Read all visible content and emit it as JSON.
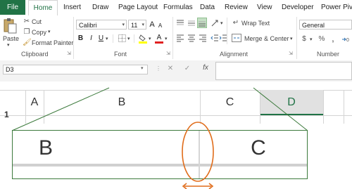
{
  "tabs": [
    "File",
    "Home",
    "Insert",
    "Draw",
    "Page Layout",
    "Formulas",
    "Data",
    "Review",
    "View",
    "Developer",
    "Power Pivot"
  ],
  "clipboard": {
    "paste": "Paste",
    "cut": "Cut",
    "copy": "Copy",
    "format_painter": "Format Painter",
    "group": "Clipboard"
  },
  "font": {
    "name": "Calibri",
    "size": "11",
    "bold": "B",
    "italic": "I",
    "underline": "U",
    "grow": "A",
    "shrink": "A",
    "color_letter": "A",
    "group": "Font"
  },
  "alignment": {
    "wrap_text": "Wrap Text",
    "merge_center": "Merge & Center",
    "group": "Alignment"
  },
  "number": {
    "format": "General",
    "currency": "$",
    "percent": "%",
    "comma": ",",
    "group": "Number"
  },
  "formula_bar": {
    "name_box": "D3",
    "cancel": "✕",
    "enter": "✓",
    "fx": "fx"
  },
  "grid": {
    "columns": [
      "A",
      "B",
      "C",
      "D"
    ],
    "row1": "1",
    "selected_column": "D"
  },
  "zoom": {
    "left": "B",
    "right": "C"
  },
  "colors": {
    "accent": "#217346",
    "highlight": "#e06c1a",
    "zoom_border": "#3c7a3c"
  }
}
